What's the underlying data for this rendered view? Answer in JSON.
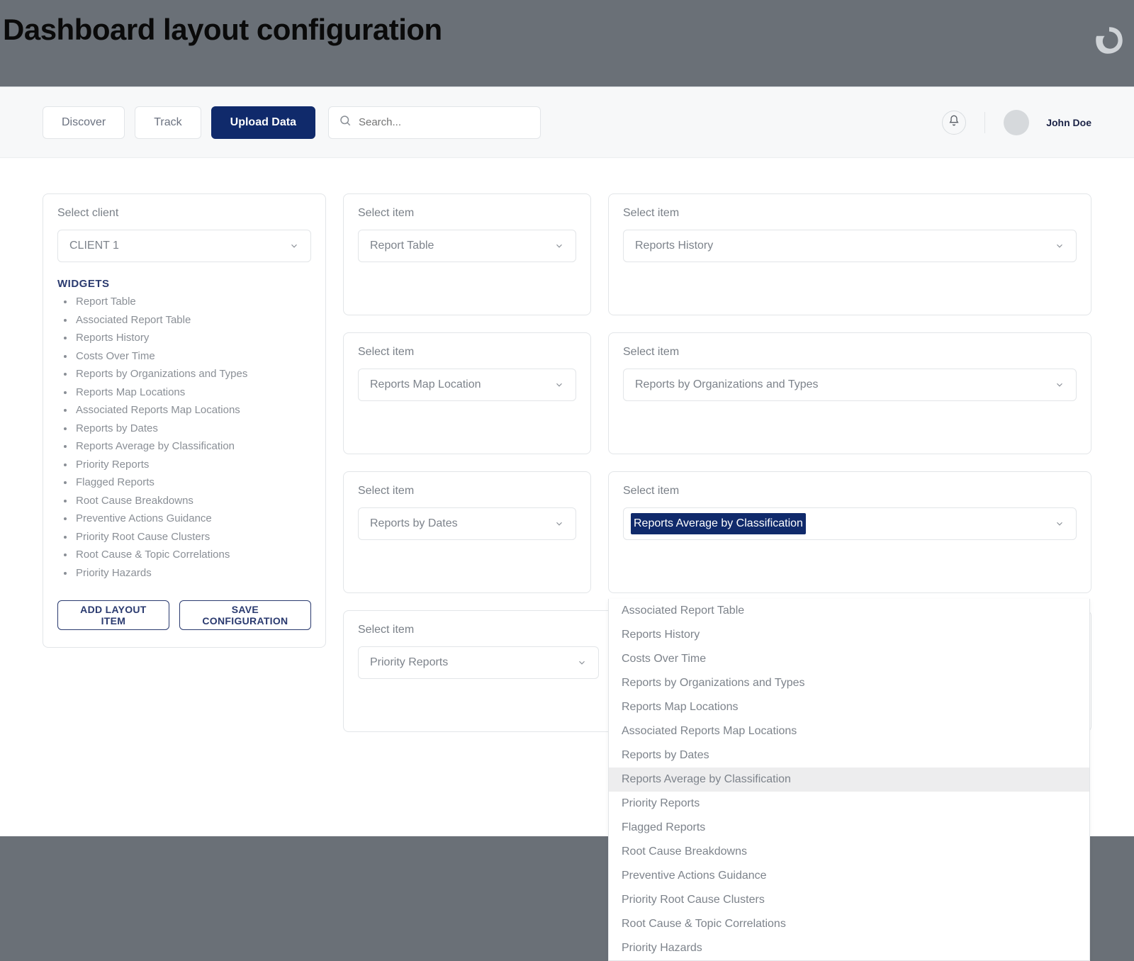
{
  "page_title": "Dashboard layout configuration",
  "nav": {
    "discover": "Discover",
    "track": "Track",
    "upload": "Upload Data"
  },
  "search_placeholder": "Search...",
  "user_name": "John Doe",
  "sidebar": {
    "title": "Select client",
    "client_value": "CLIENT 1",
    "widgets_heading": "WIDGETS",
    "widgets": [
      "Report Table",
      "Associated Report Table",
      "Reports History",
      "Costs Over Time",
      "Reports by Organizations and Types",
      "Reports Map Locations",
      "Associated Reports Map Locations",
      "Reports by Dates",
      "Reports Average by Classification",
      "Priority Reports",
      "Flagged Reports",
      "Root Cause Breakdowns",
      "Preventive Actions Guidance",
      "Priority Root Cause Clusters",
      "Root Cause & Topic Correlations",
      "Priority Hazards"
    ],
    "add_btn": "ADD LAYOUT ITEM",
    "save_btn": "SAVE CONFIGURATION"
  },
  "slot_label": "Select item",
  "slots": {
    "s1": "Report Table",
    "s2": "Reports History",
    "s3": "Reports Map Location",
    "s4": "Reports by Organizations and Types",
    "s5": "Reports by Dates",
    "s6": "Reports Average by Classification",
    "s7": "Priority Reports"
  },
  "dropdown_options": [
    "Associated Report Table",
    "Reports History",
    "Costs Over Time",
    "Reports by Organizations and Types",
    "Reports Map Locations",
    "Associated Reports Map Locations",
    "Reports by Dates",
    "Reports Average by Classification",
    "Priority Reports",
    "Flagged Reports",
    "Root Cause Breakdowns",
    "Preventive Actions Guidance",
    "Priority Root Cause Clusters",
    "Root Cause & Topic Correlations",
    "Priority Hazards"
  ],
  "dropdown_selected_idx": 7
}
